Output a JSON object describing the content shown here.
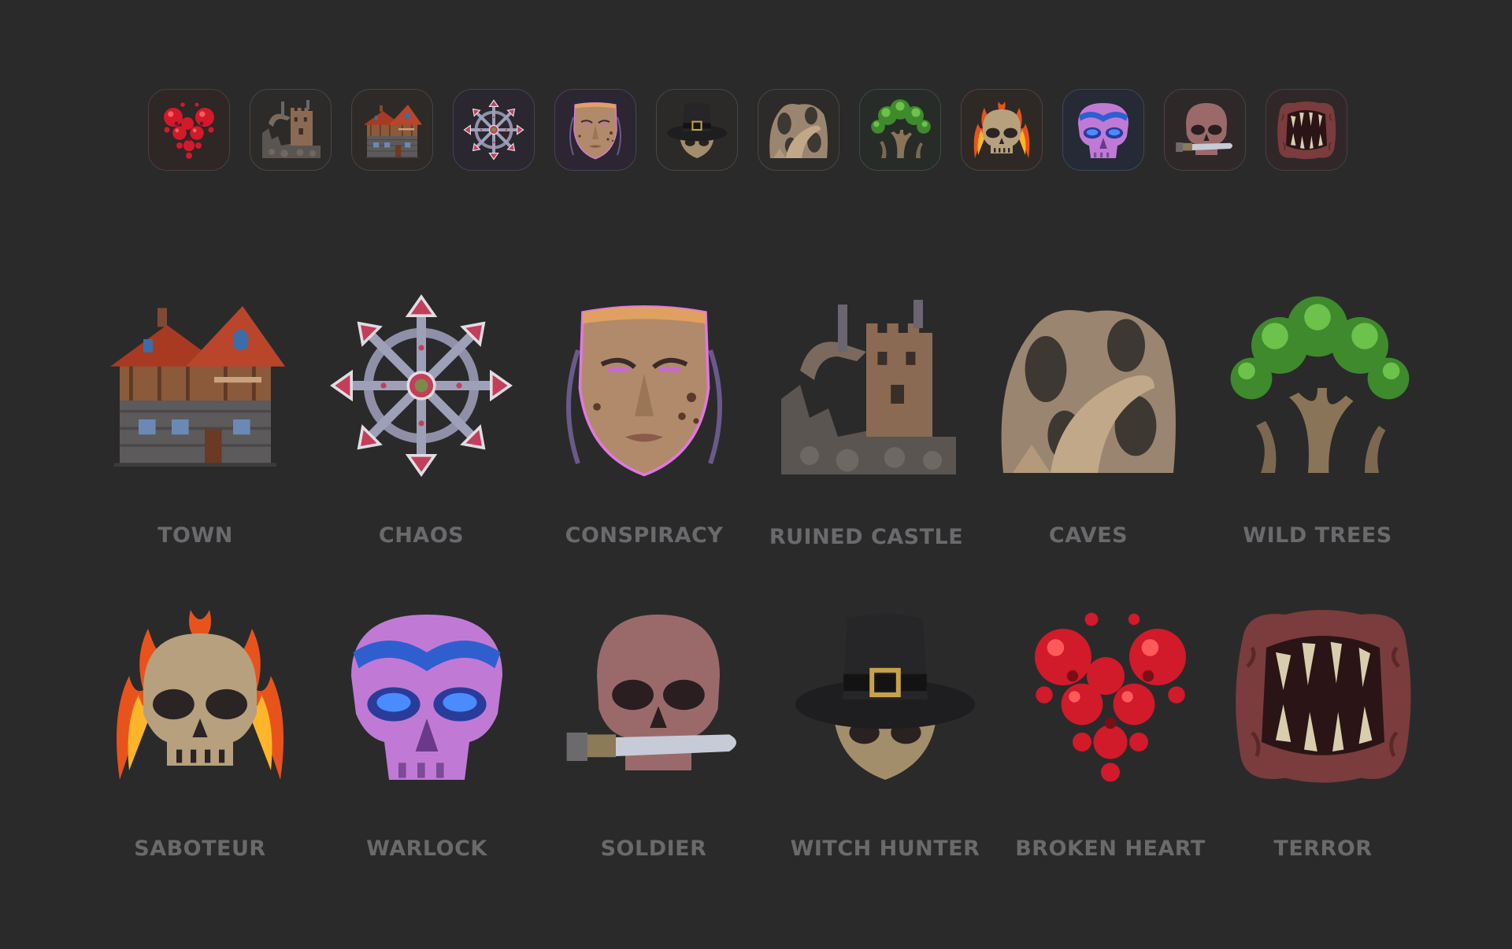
{
  "strip": {
    "icons": [
      {
        "icon": "broken-heart-icon",
        "bg": "#2f2626",
        "border": "#4a3f3f"
      },
      {
        "icon": "ruined-castle-icon",
        "bg": "#2d2b29",
        "border": "#4a4744"
      },
      {
        "icon": "town-icon",
        "bg": "#2d2a28",
        "border": "#4a4542"
      },
      {
        "icon": "chaos-icon",
        "bg": "#2b2730",
        "border": "#48424f"
      },
      {
        "icon": "conspiracy-icon",
        "bg": "#2c2532",
        "border": "#4a4154"
      },
      {
        "icon": "witch-hunter-icon",
        "bg": "#2c2a29",
        "border": "#484545"
      },
      {
        "icon": "caves-icon",
        "bg": "#2d2b29",
        "border": "#4a4744"
      },
      {
        "icon": "wild-trees-icon",
        "bg": "#272c28",
        "border": "#414a43"
      },
      {
        "icon": "saboteur-icon",
        "bg": "#2f2926",
        "border": "#4d4340"
      },
      {
        "icon": "warlock-icon",
        "bg": "#252a36",
        "border": "#3f4658"
      },
      {
        "icon": "soldier-icon",
        "bg": "#2e2829",
        "border": "#4a4244"
      },
      {
        "icon": "terror-icon",
        "bg": "#2f2728",
        "border": "#4b3f41"
      }
    ]
  },
  "grid": {
    "row1": [
      {
        "label": "TOWN",
        "icon": "town-icon"
      },
      {
        "label": "CHAOS",
        "icon": "chaos-icon"
      },
      {
        "label": "CONSPIRACY",
        "icon": "conspiracy-icon"
      },
      {
        "label": "RUINED CASTLE",
        "icon": "ruined-castle-icon"
      },
      {
        "label": "CAVES",
        "icon": "caves-icon"
      },
      {
        "label": "WILD TREES",
        "icon": "wild-trees-icon"
      }
    ],
    "row2": [
      {
        "label": "SABOTEUR",
        "icon": "saboteur-icon"
      },
      {
        "label": "WARLOCK",
        "icon": "warlock-icon"
      },
      {
        "label": "SOLDIER",
        "icon": "soldier-icon"
      },
      {
        "label": "WITCH HUNTER",
        "icon": "witch-hunter-icon"
      },
      {
        "label": "BROKEN HEART",
        "icon": "broken-heart-icon"
      },
      {
        "label": "TERROR",
        "icon": "terror-icon"
      }
    ]
  },
  "colors": {
    "background": "#2a2a2b",
    "label": "#6a6a6c"
  }
}
